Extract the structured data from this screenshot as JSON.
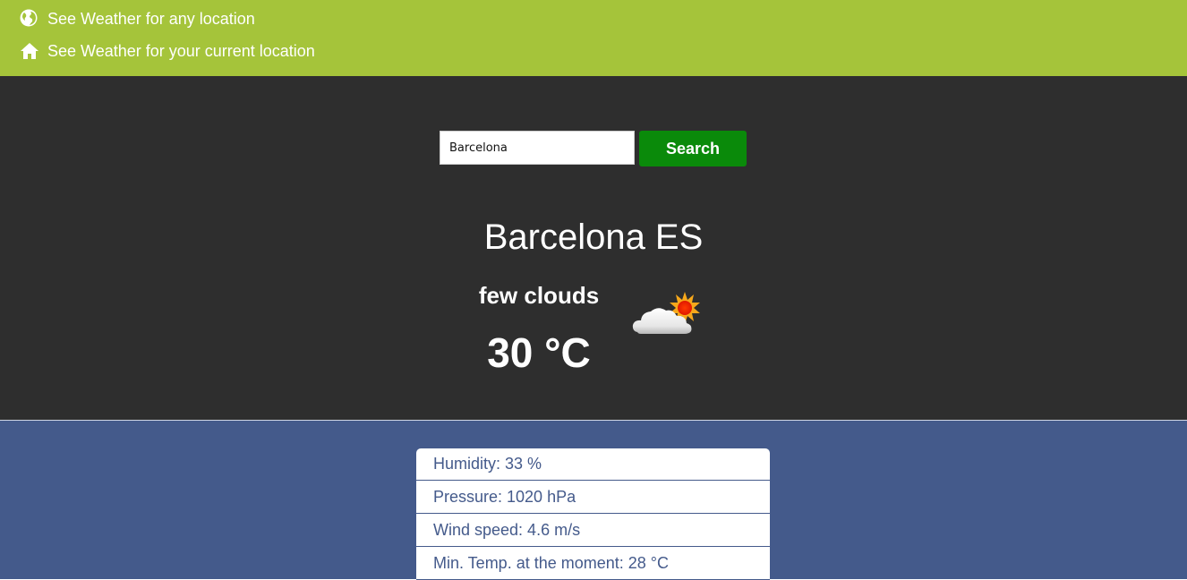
{
  "nav": {
    "any_location": {
      "label": "See Weather for any location",
      "icon": "globe-icon"
    },
    "current_location": {
      "label": "See Weather for your current location",
      "icon": "home-icon"
    }
  },
  "search": {
    "value": "Barcelona",
    "button_label": "Search"
  },
  "weather": {
    "city": "Barcelona ES",
    "description": "few clouds",
    "temperature": "30 °C",
    "icon": "few-clouds-icon"
  },
  "details": [
    {
      "text": "Humidity: 33 %"
    },
    {
      "text": "Pressure: 1020 hPa"
    },
    {
      "text": "Wind speed: 4.6 m/s"
    },
    {
      "text": "Min. Temp. at the moment: 28 °C"
    }
  ],
  "colors": {
    "nav_bg": "#a5c43a",
    "hero_bg": "#2e2e2e",
    "button_bg": "#0a8a0a",
    "details_bg": "#445a8b"
  }
}
